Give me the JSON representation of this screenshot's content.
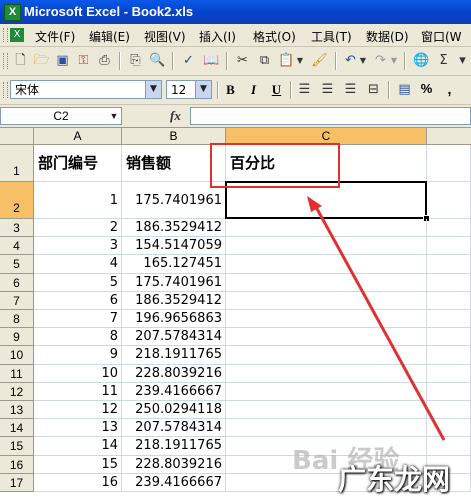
{
  "window": {
    "title": "Microsoft Excel - Book2.xls"
  },
  "menu": [
    "文件(F)",
    "编辑(E)",
    "视图(V)",
    "插入(I)",
    "格式(O)",
    "工具(T)",
    "数据(D)",
    "窗口(W"
  ],
  "format_toolbar": {
    "font": "宋体",
    "size": "12",
    "bold": "B",
    "italic": "I",
    "underline": "U",
    "percent": "%",
    "comma": ","
  },
  "formula_bar": {
    "name_box": "C2",
    "fx": "fx",
    "formula": ""
  },
  "columns": [
    "A",
    "B",
    "C"
  ],
  "rows": [
    {
      "n": "1",
      "a": "部门编号",
      "b": "销售额",
      "c": "百分比"
    },
    {
      "n": "2",
      "a": "1",
      "b": "175.7401961",
      "c": ""
    },
    {
      "n": "3",
      "a": "2",
      "b": "186.3529412",
      "c": ""
    },
    {
      "n": "4",
      "a": "3",
      "b": "154.5147059",
      "c": ""
    },
    {
      "n": "5",
      "a": "4",
      "b": "165.127451",
      "c": ""
    },
    {
      "n": "6",
      "a": "5",
      "b": "175.7401961",
      "c": ""
    },
    {
      "n": "7",
      "a": "6",
      "b": "186.3529412",
      "c": ""
    },
    {
      "n": "8",
      "a": "7",
      "b": "196.9656863",
      "c": ""
    },
    {
      "n": "9",
      "a": "8",
      "b": "207.5784314",
      "c": ""
    },
    {
      "n": "10",
      "a": "9",
      "b": "218.1911765",
      "c": ""
    },
    {
      "n": "11",
      "a": "10",
      "b": "228.8039216",
      "c": ""
    },
    {
      "n": "12",
      "a": "11",
      "b": "239.4166667",
      "c": ""
    },
    {
      "n": "13",
      "a": "12",
      "b": "250.0294118",
      "c": ""
    },
    {
      "n": "14",
      "a": "13",
      "b": "207.5784314",
      "c": ""
    },
    {
      "n": "15",
      "a": "14",
      "b": "218.1911765",
      "c": ""
    },
    {
      "n": "16",
      "a": "15",
      "b": "228.8039216",
      "c": ""
    },
    {
      "n": "17",
      "a": "16",
      "b": "239.4166667",
      "c": ""
    }
  ],
  "watermarks": {
    "baidu": "Bai 经验",
    "site": "广东龙网"
  },
  "colors": {
    "annotation": "#e03030",
    "selected_header": "#f8c066",
    "title_bar": "#0a58e6"
  }
}
